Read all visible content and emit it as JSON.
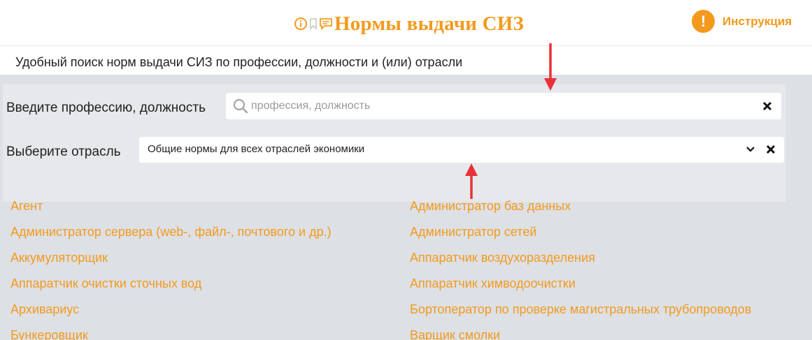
{
  "header": {
    "title": "Нормы выдачи СИЗ",
    "icons": [
      "info-icon",
      "bookmark-icon",
      "comment-icon"
    ],
    "instruction_label": "Инструкция",
    "instruction_badge": "!"
  },
  "subtitle": "Удобный поиск норм выдачи СИЗ по профессии, должности и (или) отрасли",
  "form": {
    "profession_label": "Введите профессию, должность",
    "profession_placeholder": "профессия, должность",
    "profession_value": "",
    "industry_label": "Выберите отрасль",
    "industry_value": "Общие нормы для всех отраслей экономики"
  },
  "professions": {
    "left": [
      "Агент",
      "Администратор сервера (web-, файл-, почтового и др.)",
      "Аккумуляторщик",
      "Аппаратчик очистки сточных вод",
      "Архивариус",
      "Бункеровщик"
    ],
    "right": [
      "Администратор баз данных",
      "Администратор сетей",
      "Аппаратчик воздухоразделения",
      "Аппаратчик химводоочистки",
      "Бортоператор по проверке магистральных трубопроводов",
      "Варщик смолки"
    ]
  },
  "colors": {
    "accent": "#f39a1e",
    "arrow": "#e8313a",
    "panel": "#e6e8ec",
    "background": "#dde0e5"
  }
}
